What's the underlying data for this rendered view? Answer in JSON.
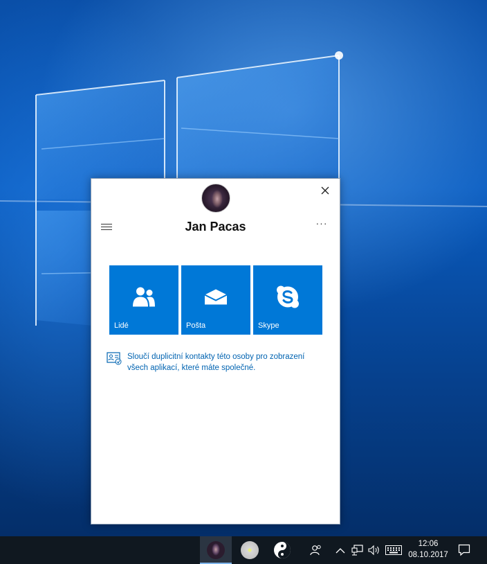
{
  "contact": {
    "name": "Jan Pacas",
    "more_label": "···"
  },
  "tiles": [
    {
      "label": "Lidé",
      "icon": "people-icon"
    },
    {
      "label": "Pošta",
      "icon": "mail-icon"
    },
    {
      "label": "Skype",
      "icon": "skype-icon"
    }
  ],
  "merge_link": {
    "line1": "Sloučí duplicitní kontakty této osoby pro zobrazení",
    "line2": "všech aplikací, které máte společné."
  },
  "taskbar": {
    "time": "12:06",
    "date": "08.10.2017"
  },
  "colors": {
    "accent": "#0078d7",
    "link": "#0063b1",
    "taskbar": "#101820"
  }
}
